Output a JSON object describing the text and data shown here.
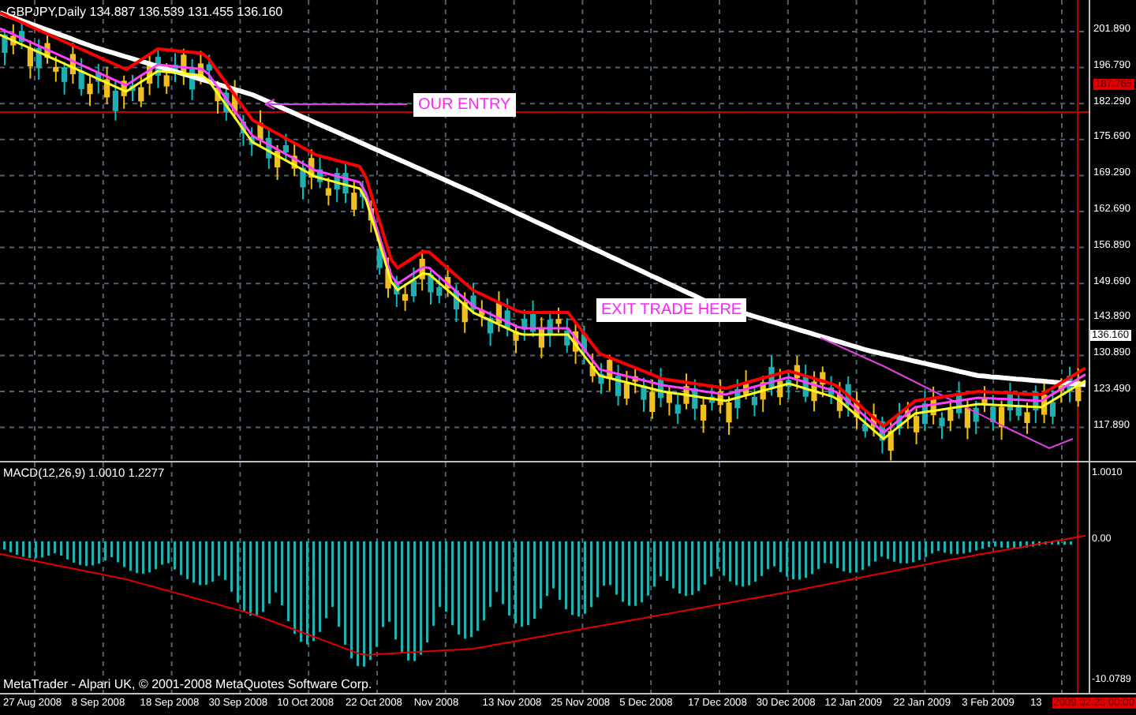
{
  "chart_title": "GBPJPY,Daily  134.887 136.539 131.455 136.160",
  "annotations": [
    {
      "kind": "entry",
      "label": "OUR ENTRY"
    },
    {
      "kind": "exit",
      "label": "EXIT TRADE HERE"
    }
  ],
  "price_axis": [
    {
      "kind": "tick",
      "label": "201.890"
    },
    {
      "kind": "tick",
      "label": "196.790"
    },
    {
      "kind": "level",
      "label": "187.765"
    },
    {
      "kind": "tick",
      "label": "182.290"
    },
    {
      "kind": "tick",
      "label": "175.690"
    },
    {
      "kind": "tick",
      "label": "169.290"
    },
    {
      "kind": "tick",
      "label": "162.690"
    },
    {
      "kind": "tick",
      "label": "156.890"
    },
    {
      "kind": "tick",
      "label": "149.690"
    },
    {
      "kind": "tick",
      "label": "143.890"
    },
    {
      "kind": "current",
      "label": "136.160"
    },
    {
      "kind": "tick",
      "label": "130.890"
    },
    {
      "kind": "tick",
      "label": "123.490"
    },
    {
      "kind": "tick",
      "label": "117.890"
    }
  ],
  "indicator": {
    "title": "MACD(12,26,9) 1.0010 1.2277",
    "axis": [
      "1.0010",
      "0.00",
      "-10.0789"
    ]
  },
  "copyright": "MetaTrader - Alpari UK, © 2001-2008 MetaQuotes Software Corp.",
  "date_axis": [
    {
      "kind": "tick",
      "label": "27 Aug 2008"
    },
    {
      "kind": "tick",
      "label": "8 Sep 2008"
    },
    {
      "kind": "tick",
      "label": "18 Sep 2008"
    },
    {
      "kind": "tick",
      "label": "30 Sep 2008"
    },
    {
      "kind": "tick",
      "label": "10 Oct 2008"
    },
    {
      "kind": "tick",
      "label": "22 Oct 2008"
    },
    {
      "kind": "tick",
      "label": "Nov 2008"
    },
    {
      "kind": "tick",
      "label": "13 Nov 2008"
    },
    {
      "kind": "tick",
      "label": "25 Nov 2008"
    },
    {
      "kind": "tick",
      "label": "5 Dec 2008"
    },
    {
      "kind": "tick",
      "label": "17 Dec 2008"
    },
    {
      "kind": "tick",
      "label": "30 Dec 2008"
    },
    {
      "kind": "tick",
      "label": "12 Jan 2009"
    },
    {
      "kind": "tick",
      "label": "22 Jan 2009"
    },
    {
      "kind": "tick",
      "label": "3 Feb 2009"
    },
    {
      "kind": "tick",
      "label": "13"
    },
    {
      "kind": "cursor",
      "label": "2009.02.23 00:00"
    }
  ]
}
